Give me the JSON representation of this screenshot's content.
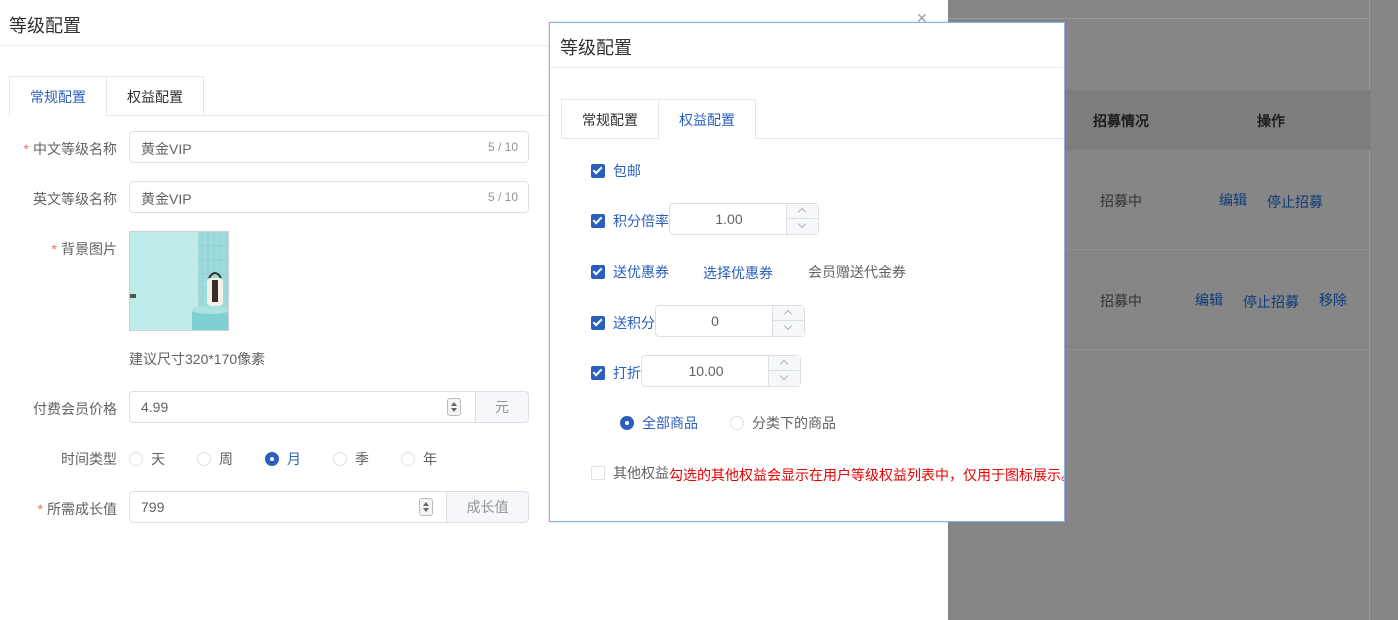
{
  "background_table": {
    "headers": [
      "招募情况",
      "操作"
    ],
    "rows": [
      {
        "status": "招募中",
        "actions": [
          "编辑",
          "停止招募"
        ]
      },
      {
        "status": "招募中",
        "actions": [
          "编辑",
          "停止招募",
          "移除"
        ]
      }
    ]
  },
  "drawer": {
    "title": "等级配置",
    "tabs": [
      {
        "label": "常规配置",
        "active": true
      },
      {
        "label": "权益配置",
        "active": false
      }
    ],
    "form": {
      "cn_name": {
        "label": "中文等级名称",
        "required": true,
        "value": "黄金VIP",
        "count": "5 / 10"
      },
      "en_name": {
        "label": "英文等级名称",
        "required": false,
        "value": "黄金VIP",
        "count": "5 / 10"
      },
      "bg_image": {
        "label": "背景图片",
        "required": true,
        "hint": "建议尺寸320*170像素"
      },
      "price": {
        "label": "付费会员价格",
        "value": "4.99",
        "unit": "元"
      },
      "time_type": {
        "label": "时间类型",
        "options": [
          "天",
          "周",
          "月",
          "季",
          "年"
        ],
        "selected": "月"
      },
      "growth": {
        "label": "所需成长值",
        "required": true,
        "value": "799",
        "unit": "成长值"
      }
    }
  },
  "dialog": {
    "title": "等级配置",
    "tabs": [
      {
        "label": "常规配置",
        "active": false
      },
      {
        "label": "权益配置",
        "active": true
      }
    ],
    "benefits": {
      "free_shipping": {
        "label": "包邮",
        "checked": true
      },
      "points_rate": {
        "label": "积分倍率",
        "checked": true,
        "value": "1.00"
      },
      "coupon": {
        "label": "送优惠券",
        "checked": true,
        "select_link": "选择优惠券",
        "coupon_name": "会员赠送代金券"
      },
      "send_points": {
        "label": "送积分",
        "checked": true,
        "value": "0"
      },
      "discount": {
        "label": "打折",
        "checked": true,
        "value": "10.00"
      },
      "discount_scope": {
        "options": [
          "全部商品",
          "分类下的商品"
        ],
        "selected": "全部商品"
      },
      "other": {
        "label": "其他权益",
        "checked": false,
        "warning": "勾选的其他权益会显示在用户等级权益列表中，仅用于图标展示。"
      }
    }
  },
  "colors": {
    "primary": "#2b5fbf",
    "required": "#f56c6c",
    "warning": "#e60000",
    "overlay": "#868686"
  }
}
